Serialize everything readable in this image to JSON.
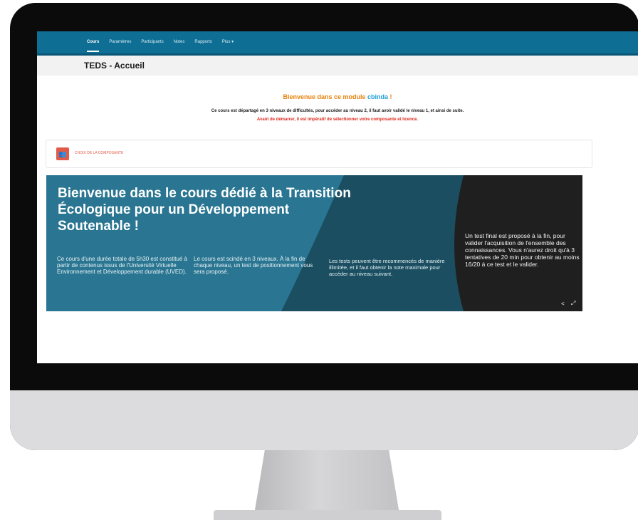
{
  "nav": {
    "tabs": [
      {
        "label": "Cours",
        "active": true
      },
      {
        "label": "Paramètres"
      },
      {
        "label": "Participants"
      },
      {
        "label": "Notes"
      },
      {
        "label": "Rapports"
      },
      {
        "label": "Plus ▾"
      }
    ]
  },
  "header": {
    "title": "TEDS - Accueil"
  },
  "intro": {
    "welcome_prefix": "Bienvenue dans ce module ",
    "welcome_brand": "cbinda",
    "welcome_suffix": " !",
    "line1": "Ce cours est départagé en 3 niveaux de difficultés, pour accéder au niveau 2, il faut avoir validé le niveau 1, et ainsi de suite.",
    "line2": "Avant de démarrer, il est impératif de sélectionner votre composante et licence."
  },
  "card": {
    "label": "CHOIX DE LA COMPOSANTE"
  },
  "banner": {
    "title": "Bienvenue dans le cours dédié à la Transition Écologique pour un Développement Soutenable !",
    "col1": "Ce cours d'une durée totale de 5h30 est constitué à partir de contenus issus de l'Université Virtuelle Environnement et Développement durable (UVED).",
    "col2": "Le cours est scindé en 3 niveaux. À la fin de chaque niveau, un test de positionnement vous sera proposé.",
    "col3": "Les tests peuvent être recommencés de manière illimitée, et il faut obtenir la note maximale pour accéder au niveau suivant.",
    "col4": "Un test final est proposé à la fin, pour valider l'acquisition de l'ensemble des connaissances. Vous n'aurez droit qu'à 3 tentatives de 20 min pour obtenir au moins 16/20 à ce test et le valider.",
    "share_glyph": "<",
    "expand_glyph": "⤢"
  },
  "colors": {
    "nav": "#0f6e93",
    "accent_orange": "#e8810a",
    "accent_red": "#e0271b",
    "banner_blue": "#2a7591",
    "banner_dark_teal": "#1a4e60",
    "banner_black": "#1f1f1f"
  }
}
